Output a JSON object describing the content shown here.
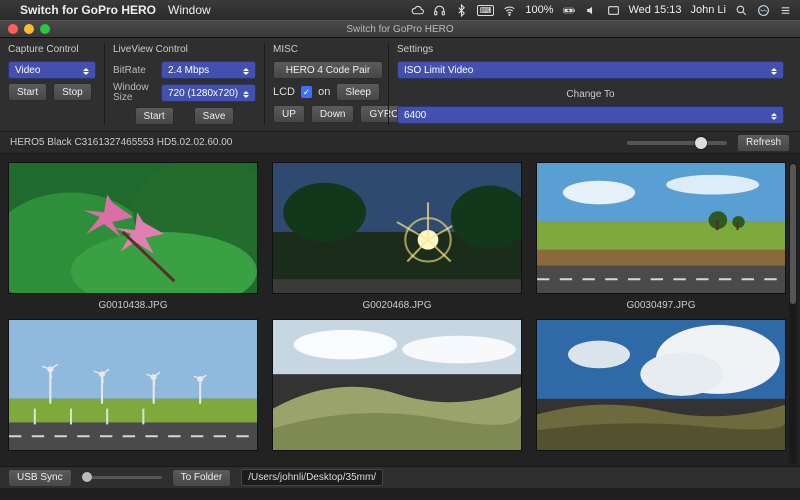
{
  "menubar": {
    "app_name": "Switch for GoPro HERO",
    "menu_window": "Window",
    "battery": "100%",
    "clock": "Wed 15:13",
    "user": "John Li"
  },
  "titlebar": {
    "title": "Switch for GoPro HERO"
  },
  "capture": {
    "title": "Capture Control",
    "mode": "Video",
    "start": "Start",
    "stop": "Stop"
  },
  "liveview": {
    "title": "LiveView Control",
    "bitrate_label": "BitRate",
    "bitrate": "2.4 Mbps",
    "winsize_label": "Window Size",
    "winsize": "720 (1280x720)",
    "start": "Start",
    "save": "Save"
  },
  "misc": {
    "title": "MISC",
    "pair": "HERO 4 Code Pair",
    "lcd_label": "LCD",
    "lcd_on": "on",
    "sleep": "Sleep",
    "up": "UP",
    "down": "Down",
    "gyro": "GYRO"
  },
  "settings": {
    "title": "Settings",
    "preset": "ISO Limit Video",
    "change_to": "Change To",
    "value": "6400"
  },
  "device_line": "HERO5 Black C3161327465553 HD5.02.02.60.00",
  "refresh": "Refresh",
  "thumbs": [
    {
      "name": "G0010438.JPG"
    },
    {
      "name": "G0020468.JPG"
    },
    {
      "name": "G0030497.JPG"
    }
  ],
  "footer": {
    "usb_sync": "USB Sync",
    "to_folder": "To Folder",
    "path": "/Users/johnli/Desktop/35mm/"
  }
}
